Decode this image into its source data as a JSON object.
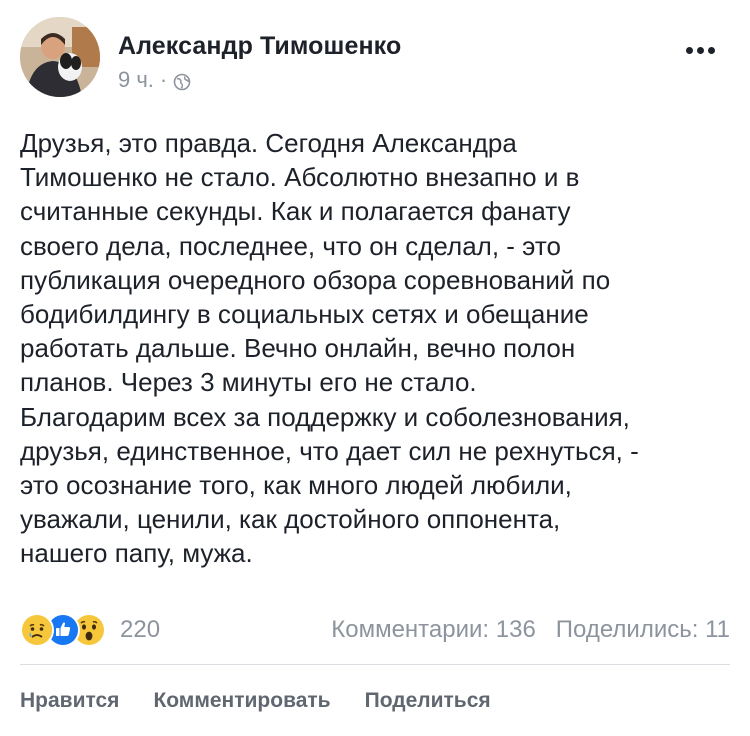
{
  "post": {
    "author": "Александр Тимошенко",
    "time": "9 ч.",
    "dot": "·",
    "privacy_icon": "globe-icon",
    "more_icon": "more-horizontal-icon",
    "text": "Друзья, это правда. Сегодня Александра\nТимошенко не стало. Абсолютно внезапно и в\nсчитанные секунды. Как и полагается фанату\nсвоего дела, последнее, что он сделал, - это\nпубликация очередного обзора соревнований по\nбодибилдингу в социальных сетях и обещание\nработать дальше. Вечно онлайн, вечно полон\nпланов. Через 3 минуты его не стало.\nБлагодарим всех за поддержку и соболезнования,\nдрузья, единственное, что дает сил не рехнуться, -\nэто осознание того, как много людей любили,\nуважали, ценили, как достойного оппонента,\nнашего папу, мужа."
  },
  "stats": {
    "reactions": [
      "sad-reaction-icon",
      "like-reaction-icon",
      "wow-reaction-icon"
    ],
    "reaction_count": "220",
    "comments": "Комментарии: 136",
    "shares": "Поделились: 11"
  },
  "actions": {
    "like": "Нравится",
    "comment": "Комментировать",
    "share": "Поделиться"
  },
  "colors": {
    "text": "#1d2129",
    "muted": "#8d949e",
    "action": "#606770",
    "like_blue": "#1877f2",
    "reaction_yellow": "#f7c73b"
  }
}
